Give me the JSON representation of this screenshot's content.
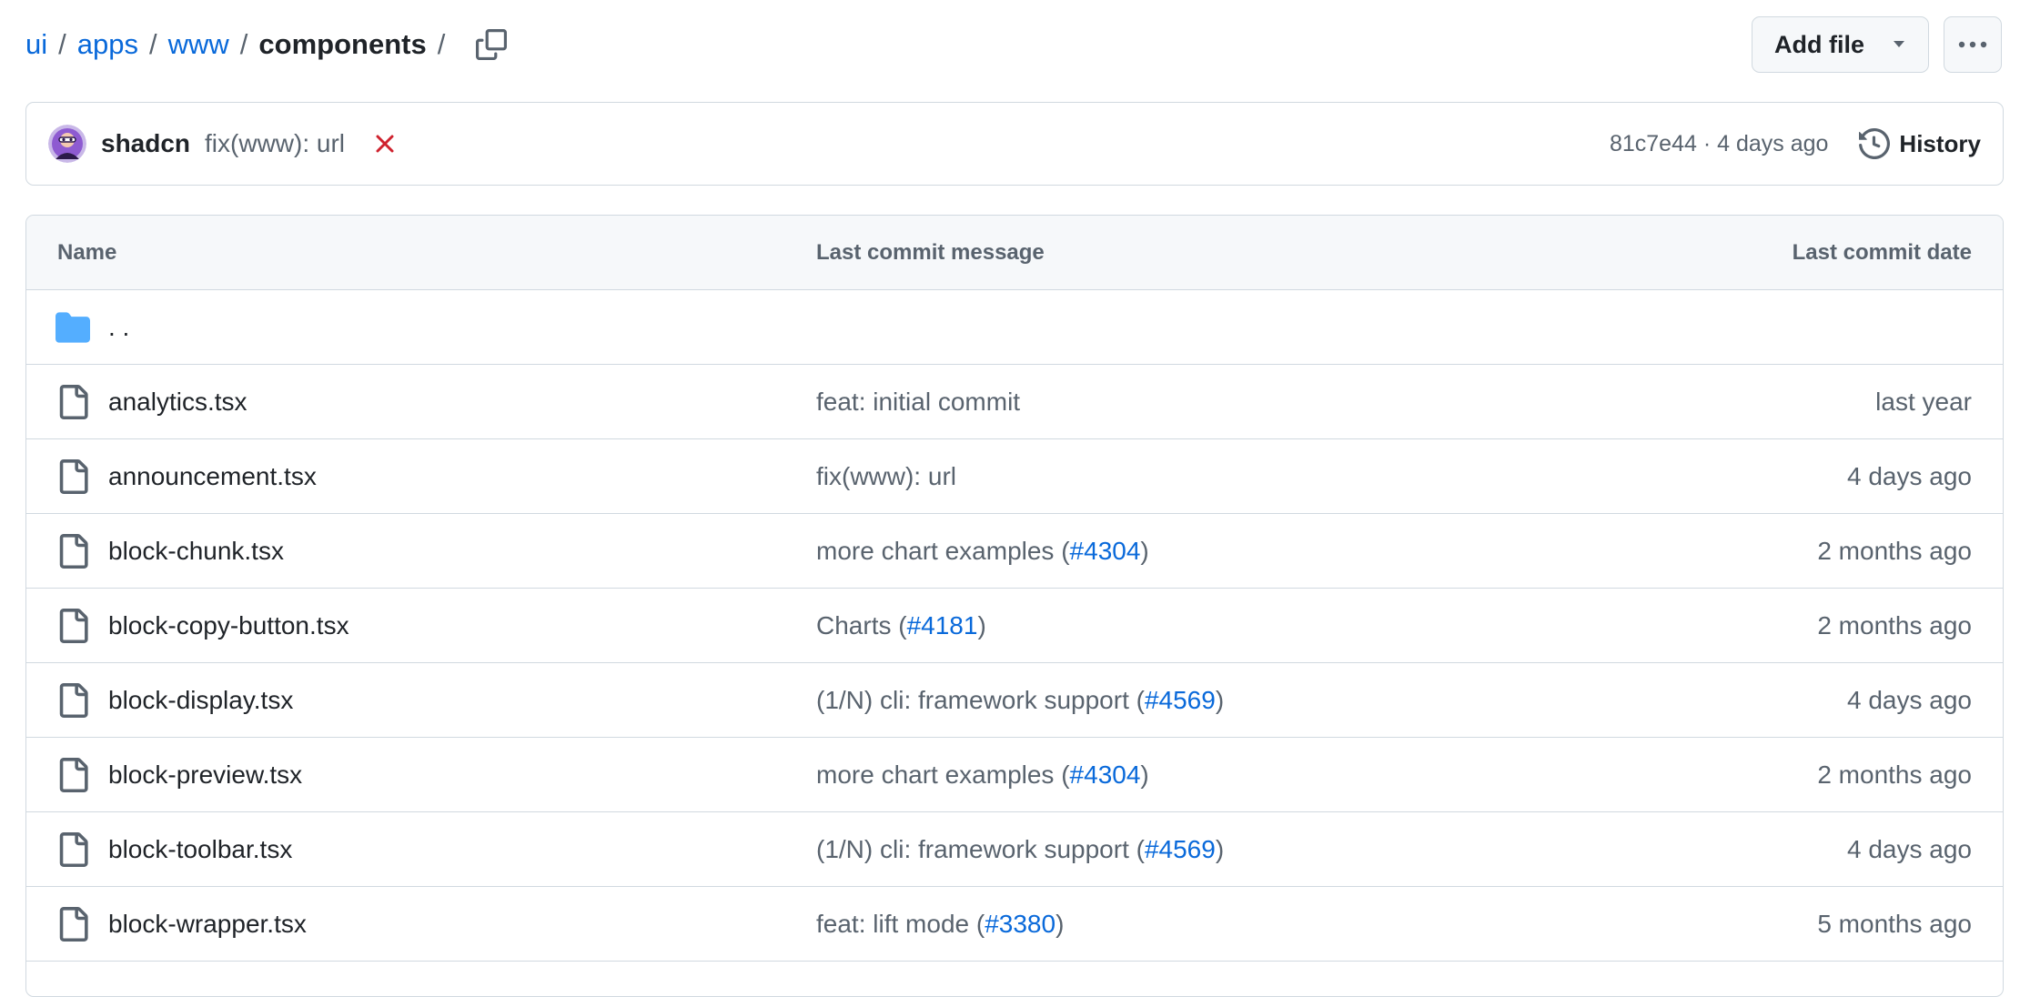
{
  "breadcrumb": {
    "items": [
      "ui",
      "apps",
      "www"
    ],
    "separator": "/",
    "current": "components",
    "trailing_separator": "/"
  },
  "toolbar": {
    "add_file_label": "Add file",
    "more_icon": "kebab-horizontal-icon"
  },
  "latest_commit": {
    "author": "shadcn",
    "message": "fix(www): url",
    "status": "failed",
    "status_color": "#cf222e",
    "meta": "81c7e44 · 4 days ago",
    "history_label": "History"
  },
  "table": {
    "headers": {
      "name": "Name",
      "message": "Last commit message",
      "date": "Last commit date"
    },
    "parent_label": ". .",
    "rows": [
      {
        "name": "analytics.tsx",
        "msg_pre": "feat: initial commit",
        "pr": "",
        "msg_post": "",
        "date": "last year"
      },
      {
        "name": "announcement.tsx",
        "msg_pre": "fix(www): url",
        "pr": "",
        "msg_post": "",
        "date": "4 days ago"
      },
      {
        "name": "block-chunk.tsx",
        "msg_pre": "more chart examples (",
        "pr": "#4304",
        "msg_post": ")",
        "date": "2 months ago"
      },
      {
        "name": "block-copy-button.tsx",
        "msg_pre": "Charts (",
        "pr": "#4181",
        "msg_post": ")",
        "date": "2 months ago"
      },
      {
        "name": "block-display.tsx",
        "msg_pre": "(1/N) cli: framework support (",
        "pr": "#4569",
        "msg_post": ")",
        "date": "4 days ago"
      },
      {
        "name": "block-preview.tsx",
        "msg_pre": "more chart examples (",
        "pr": "#4304",
        "msg_post": ")",
        "date": "2 months ago"
      },
      {
        "name": "block-toolbar.tsx",
        "msg_pre": "(1/N) cli: framework support (",
        "pr": "#4569",
        "msg_post": ")",
        "date": "4 days ago"
      },
      {
        "name": "block-wrapper.tsx",
        "msg_pre": "feat: lift mode (",
        "pr": "#3380",
        "msg_post": ")",
        "date": "5 months ago"
      }
    ]
  },
  "colors": {
    "link": "#0969da",
    "muted": "#59636e",
    "folder": "#54aeff",
    "border": "#d1d9e0"
  }
}
